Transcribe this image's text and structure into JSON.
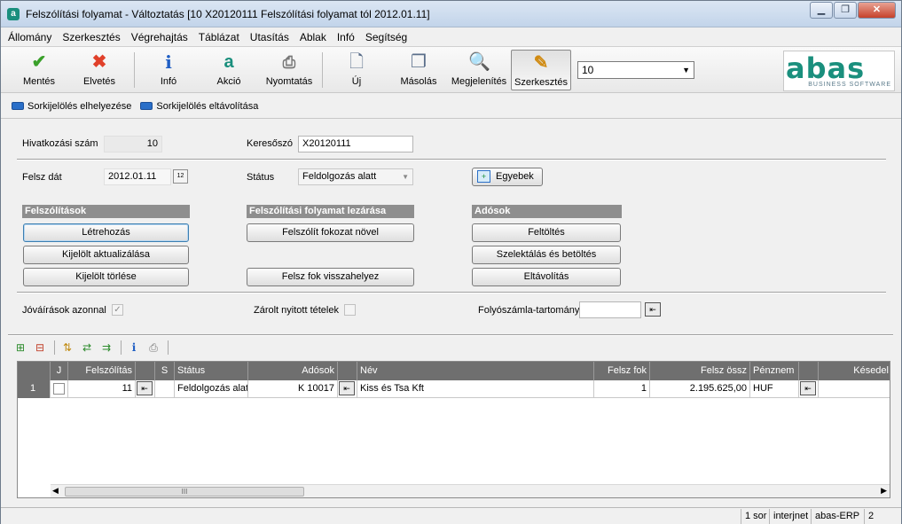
{
  "window": {
    "title": "Felszólítási folyamat - Változtatás  [10   X20120111   Felszólítási folyamat tól 2012.01.11]",
    "minimize": "▁",
    "maximize": "❐",
    "close": "✕"
  },
  "menu": [
    "Állomány",
    "Szerkesztés",
    "Végrehajtás",
    "Táblázat",
    "Utasítás",
    "Ablak",
    "Infó",
    "Segítség"
  ],
  "toolbar": {
    "save": "Mentés",
    "discard": "Elvetés",
    "info": "Infó",
    "action": "Akció",
    "print": "Nyomtatás",
    "new": "Új",
    "copy": "Másolás",
    "view": "Megjelenítés",
    "edit": "Szerkesztés",
    "combo_value": "10",
    "logo_text": "abas",
    "logo_sub": "BUSINESS SOFTWARE"
  },
  "bookmarks": {
    "place": "Sorkijelölés elhelyezése",
    "remove": "Sorkijelölés eltávolítása"
  },
  "form": {
    "ref_label": "Hivatkozási szám",
    "ref_value": "10",
    "keyword_label": "Keresőszó",
    "keyword_value": "X20120111",
    "date_label": "Felsz dát",
    "date_value": "2012.01.11",
    "date_icon": "12",
    "status_label": "Státus",
    "status_value": "Feldolgozás alatt",
    "other_button": "Egyebek",
    "credits_label": "Jóváírások azonnal",
    "credits_check": "✓",
    "locked_label": "Zárolt nyitott tételek",
    "range_label": "Folyószámla-tartomány",
    "range_value": ""
  },
  "sections": {
    "reminders": {
      "title": "Felszólítások",
      "create": "Létrehozás",
      "update": "Kijelölt aktualizálása",
      "delete": "Kijelölt törlése"
    },
    "closing": {
      "title": "Felszólítási folyamat lezárása",
      "raise": "Felszólít fokozat növel",
      "reset": "Felsz fok visszahelyez"
    },
    "debtors": {
      "title": "Adósok",
      "fill": "Feltöltés",
      "select": "Szelektálás és betöltés",
      "remove": "Eltávolítás"
    }
  },
  "grid": {
    "columns": [
      "",
      "J",
      "Felszólítás",
      "",
      "S",
      "Státus",
      "Adósok",
      "",
      "Név",
      "Felsz fok",
      "Felsz össz",
      "Pénznem",
      "",
      "Késedel"
    ],
    "rows": [
      {
        "num": "1",
        "reminder": "11",
        "status": "Feldolgozás alatt",
        "debtor": "K 10017",
        "name": "Kiss és Tsa Kft",
        "level": "1",
        "total": "2.195.625,00",
        "currency": "HUF"
      }
    ],
    "scroll_label": "III"
  },
  "statusbar": {
    "rows": "1 sor",
    "mode": "interjnet",
    "system": "abas-ERP",
    "num": "2"
  }
}
